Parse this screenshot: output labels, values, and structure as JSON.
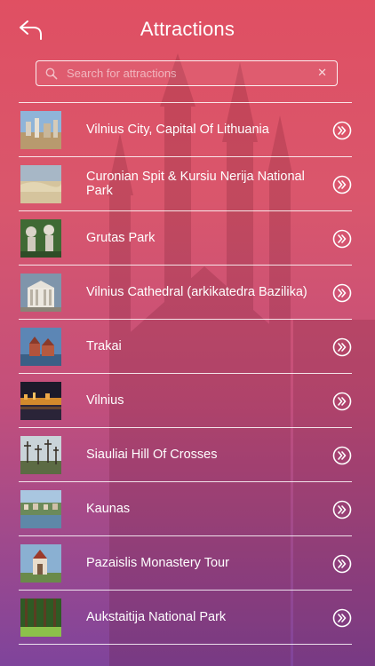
{
  "header": {
    "title": "Attractions",
    "back_icon": "back-arrow-icon"
  },
  "search": {
    "placeholder": "Search for attractions",
    "value": ""
  },
  "attractions": [
    {
      "label": "Vilnius City, Capital Of Lithuania",
      "thumb_icon": "city-photo"
    },
    {
      "label": "Curonian Spit & Kursiu Nerija National Park",
      "thumb_icon": "dunes-photo"
    },
    {
      "label": "Grutas Park",
      "thumb_icon": "statues-photo"
    },
    {
      "label": "Vilnius Cathedral (arkikatedra Bazilika)",
      "thumb_icon": "cathedral-photo"
    },
    {
      "label": "Trakai",
      "thumb_icon": "castle-photo"
    },
    {
      "label": "Vilnius",
      "thumb_icon": "night-city-photo"
    },
    {
      "label": "Siauliai Hill Of Crosses",
      "thumb_icon": "crosses-photo"
    },
    {
      "label": "Kaunas",
      "thumb_icon": "river-city-photo"
    },
    {
      "label": "Pazaislis Monastery Tour",
      "thumb_icon": "monastery-photo"
    },
    {
      "label": "Aukstaitija National Park",
      "thumb_icon": "forest-photo"
    }
  ],
  "colors": {
    "text": "#ffffff",
    "background_top": "#de465a",
    "background_bottom": "#783a96"
  }
}
